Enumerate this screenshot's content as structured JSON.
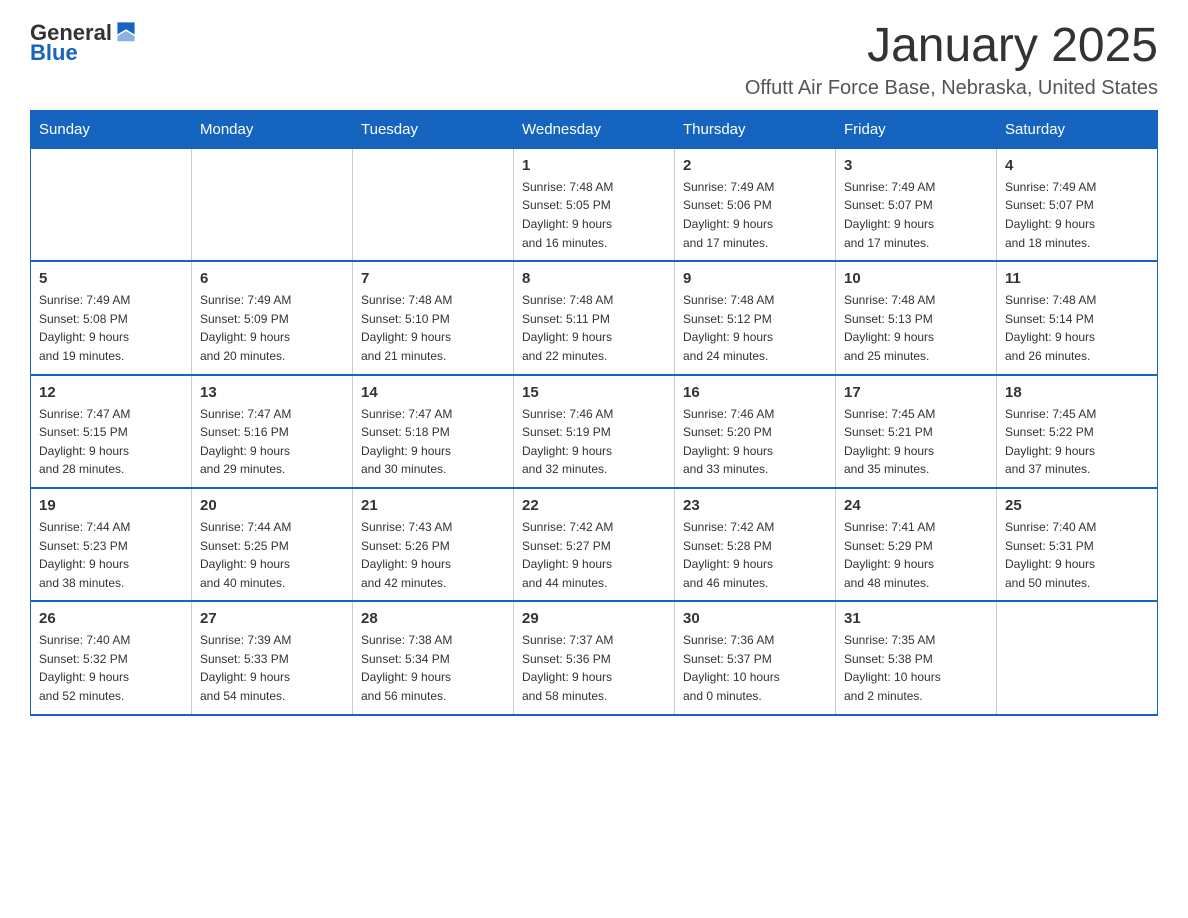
{
  "logo": {
    "text_general": "General",
    "text_blue": "Blue"
  },
  "title": "January 2025",
  "subtitle": "Offutt Air Force Base, Nebraska, United States",
  "header_color": "#1565c0",
  "days_of_week": [
    "Sunday",
    "Monday",
    "Tuesday",
    "Wednesday",
    "Thursday",
    "Friday",
    "Saturday"
  ],
  "weeks": [
    [
      {
        "day": "",
        "info": ""
      },
      {
        "day": "",
        "info": ""
      },
      {
        "day": "",
        "info": ""
      },
      {
        "day": "1",
        "info": "Sunrise: 7:48 AM\nSunset: 5:05 PM\nDaylight: 9 hours\nand 16 minutes."
      },
      {
        "day": "2",
        "info": "Sunrise: 7:49 AM\nSunset: 5:06 PM\nDaylight: 9 hours\nand 17 minutes."
      },
      {
        "day": "3",
        "info": "Sunrise: 7:49 AM\nSunset: 5:07 PM\nDaylight: 9 hours\nand 17 minutes."
      },
      {
        "day": "4",
        "info": "Sunrise: 7:49 AM\nSunset: 5:07 PM\nDaylight: 9 hours\nand 18 minutes."
      }
    ],
    [
      {
        "day": "5",
        "info": "Sunrise: 7:49 AM\nSunset: 5:08 PM\nDaylight: 9 hours\nand 19 minutes."
      },
      {
        "day": "6",
        "info": "Sunrise: 7:49 AM\nSunset: 5:09 PM\nDaylight: 9 hours\nand 20 minutes."
      },
      {
        "day": "7",
        "info": "Sunrise: 7:48 AM\nSunset: 5:10 PM\nDaylight: 9 hours\nand 21 minutes."
      },
      {
        "day": "8",
        "info": "Sunrise: 7:48 AM\nSunset: 5:11 PM\nDaylight: 9 hours\nand 22 minutes."
      },
      {
        "day": "9",
        "info": "Sunrise: 7:48 AM\nSunset: 5:12 PM\nDaylight: 9 hours\nand 24 minutes."
      },
      {
        "day": "10",
        "info": "Sunrise: 7:48 AM\nSunset: 5:13 PM\nDaylight: 9 hours\nand 25 minutes."
      },
      {
        "day": "11",
        "info": "Sunrise: 7:48 AM\nSunset: 5:14 PM\nDaylight: 9 hours\nand 26 minutes."
      }
    ],
    [
      {
        "day": "12",
        "info": "Sunrise: 7:47 AM\nSunset: 5:15 PM\nDaylight: 9 hours\nand 28 minutes."
      },
      {
        "day": "13",
        "info": "Sunrise: 7:47 AM\nSunset: 5:16 PM\nDaylight: 9 hours\nand 29 minutes."
      },
      {
        "day": "14",
        "info": "Sunrise: 7:47 AM\nSunset: 5:18 PM\nDaylight: 9 hours\nand 30 minutes."
      },
      {
        "day": "15",
        "info": "Sunrise: 7:46 AM\nSunset: 5:19 PM\nDaylight: 9 hours\nand 32 minutes."
      },
      {
        "day": "16",
        "info": "Sunrise: 7:46 AM\nSunset: 5:20 PM\nDaylight: 9 hours\nand 33 minutes."
      },
      {
        "day": "17",
        "info": "Sunrise: 7:45 AM\nSunset: 5:21 PM\nDaylight: 9 hours\nand 35 minutes."
      },
      {
        "day": "18",
        "info": "Sunrise: 7:45 AM\nSunset: 5:22 PM\nDaylight: 9 hours\nand 37 minutes."
      }
    ],
    [
      {
        "day": "19",
        "info": "Sunrise: 7:44 AM\nSunset: 5:23 PM\nDaylight: 9 hours\nand 38 minutes."
      },
      {
        "day": "20",
        "info": "Sunrise: 7:44 AM\nSunset: 5:25 PM\nDaylight: 9 hours\nand 40 minutes."
      },
      {
        "day": "21",
        "info": "Sunrise: 7:43 AM\nSunset: 5:26 PM\nDaylight: 9 hours\nand 42 minutes."
      },
      {
        "day": "22",
        "info": "Sunrise: 7:42 AM\nSunset: 5:27 PM\nDaylight: 9 hours\nand 44 minutes."
      },
      {
        "day": "23",
        "info": "Sunrise: 7:42 AM\nSunset: 5:28 PM\nDaylight: 9 hours\nand 46 minutes."
      },
      {
        "day": "24",
        "info": "Sunrise: 7:41 AM\nSunset: 5:29 PM\nDaylight: 9 hours\nand 48 minutes."
      },
      {
        "day": "25",
        "info": "Sunrise: 7:40 AM\nSunset: 5:31 PM\nDaylight: 9 hours\nand 50 minutes."
      }
    ],
    [
      {
        "day": "26",
        "info": "Sunrise: 7:40 AM\nSunset: 5:32 PM\nDaylight: 9 hours\nand 52 minutes."
      },
      {
        "day": "27",
        "info": "Sunrise: 7:39 AM\nSunset: 5:33 PM\nDaylight: 9 hours\nand 54 minutes."
      },
      {
        "day": "28",
        "info": "Sunrise: 7:38 AM\nSunset: 5:34 PM\nDaylight: 9 hours\nand 56 minutes."
      },
      {
        "day": "29",
        "info": "Sunrise: 7:37 AM\nSunset: 5:36 PM\nDaylight: 9 hours\nand 58 minutes."
      },
      {
        "day": "30",
        "info": "Sunrise: 7:36 AM\nSunset: 5:37 PM\nDaylight: 10 hours\nand 0 minutes."
      },
      {
        "day": "31",
        "info": "Sunrise: 7:35 AM\nSunset: 5:38 PM\nDaylight: 10 hours\nand 2 minutes."
      },
      {
        "day": "",
        "info": ""
      }
    ]
  ]
}
